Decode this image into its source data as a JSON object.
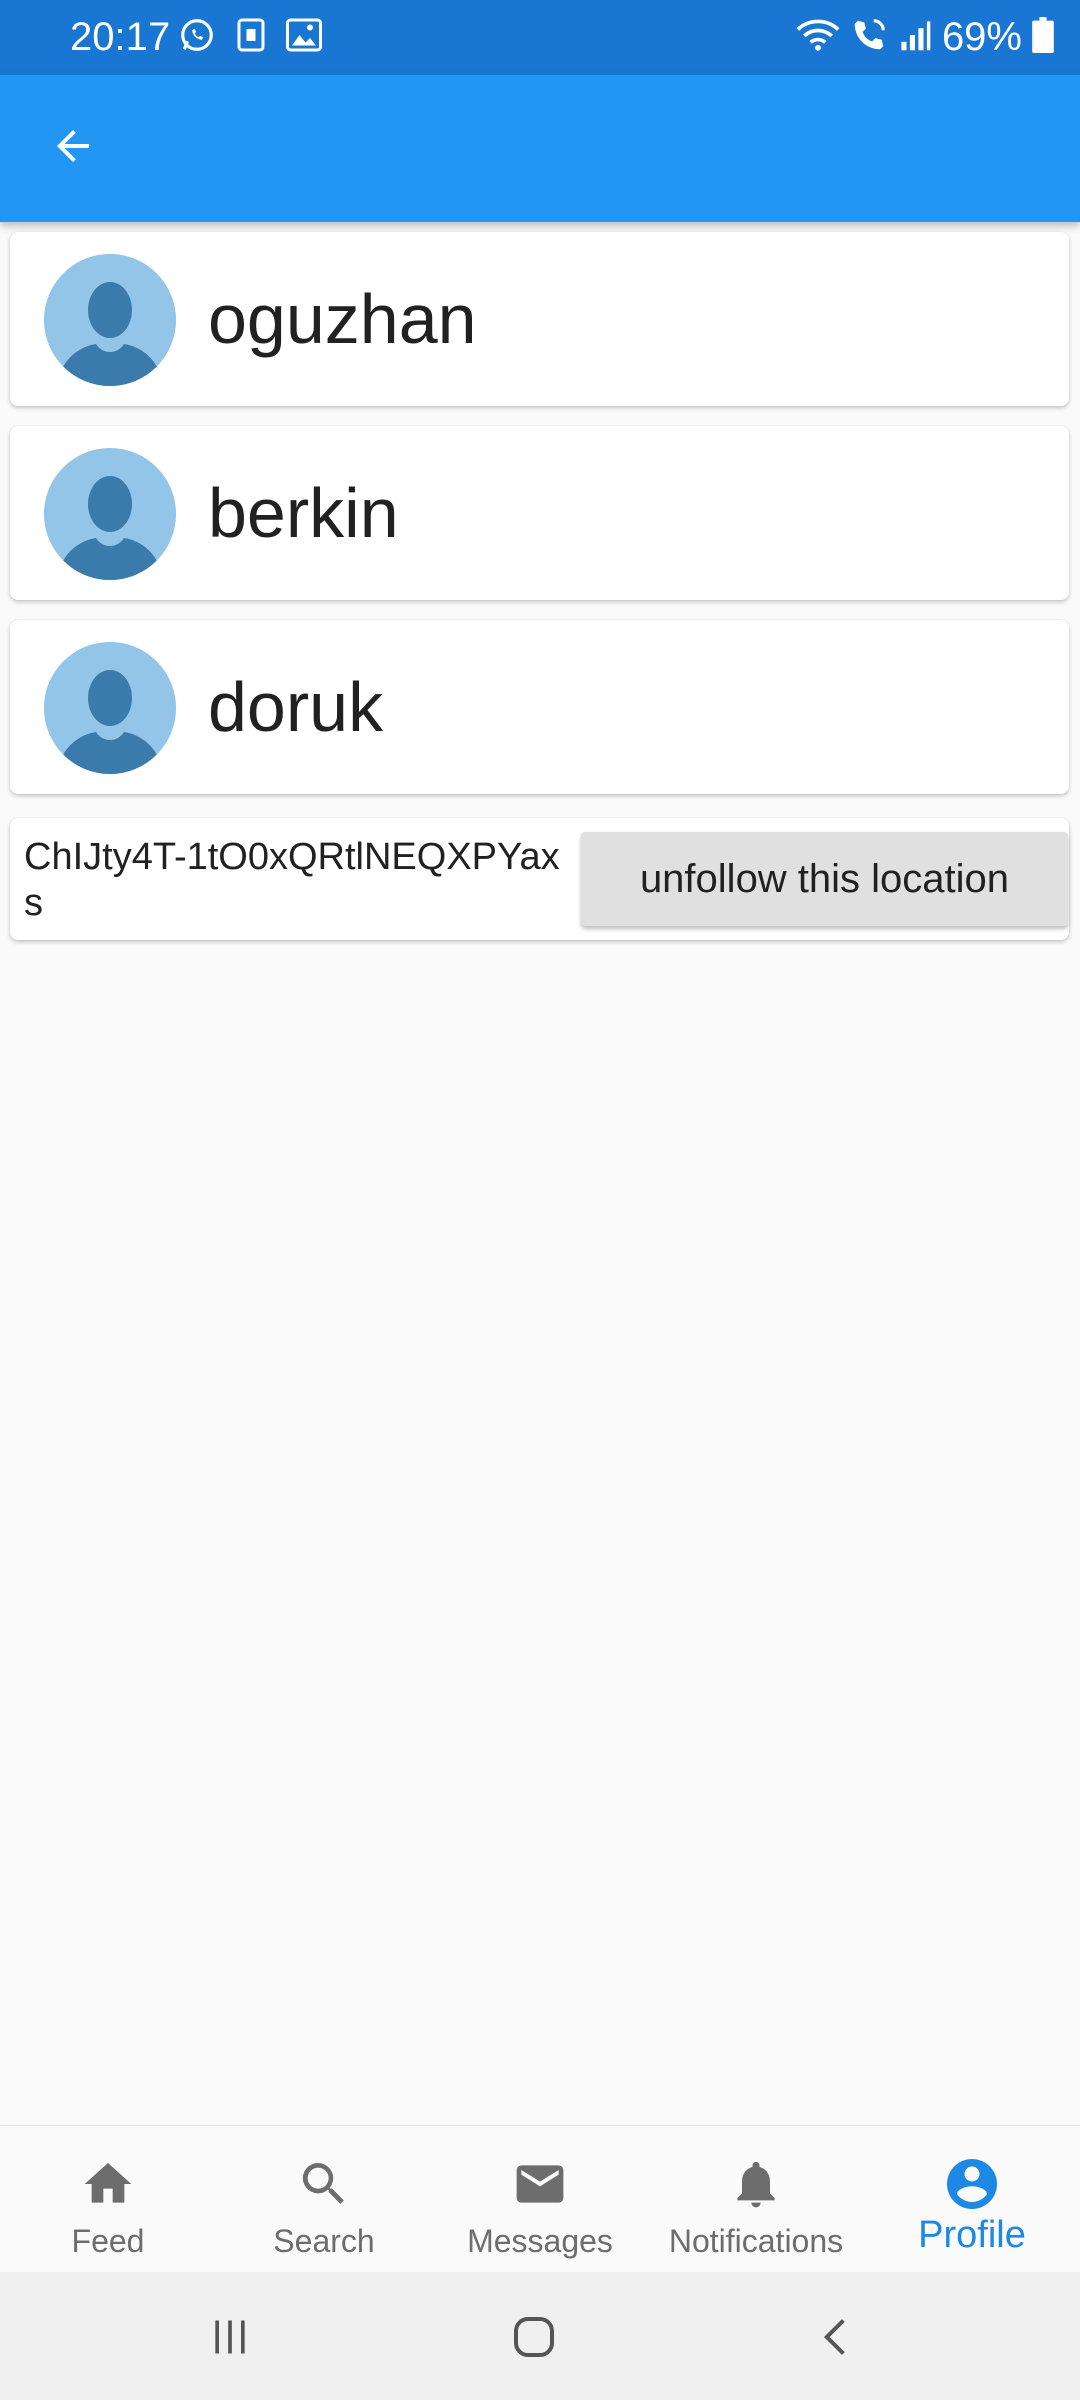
{
  "status_bar": {
    "time": "20:17",
    "battery_percent": "69%",
    "left_icons": [
      "whatsapp-icon",
      "sim-icon",
      "gallery-icon"
    ],
    "right_icons": [
      "wifi-icon",
      "wifi-calling-icon",
      "signal-icon",
      "battery-icon"
    ]
  },
  "app_bar": {
    "back_icon": "arrow-left-icon",
    "color": "#2196f3"
  },
  "users": [
    {
      "name": "oguzhan",
      "avatar_icon": "default-avatar-icon"
    },
    {
      "name": "berkin",
      "avatar_icon": "default-avatar-icon"
    },
    {
      "name": "doruk",
      "avatar_icon": "default-avatar-icon"
    }
  ],
  "location": {
    "id_text": "ChIJty4T-1tO0xQRtlNEQXPYaxs",
    "unfollow_label": "unfollow this location"
  },
  "bottom_nav": {
    "items": [
      {
        "label": "Feed",
        "icon": "home-icon",
        "active": false
      },
      {
        "label": "Search",
        "icon": "search-icon",
        "active": false
      },
      {
        "label": "Messages",
        "icon": "mail-icon",
        "active": false
      },
      {
        "label": "Notifications",
        "icon": "bell-icon",
        "active": false
      },
      {
        "label": "Profile",
        "icon": "account-circle-icon",
        "active": true
      }
    ],
    "active_color": "#1e88e5",
    "inactive_color": "#6d6d6d"
  },
  "system_nav": {
    "buttons": [
      "recents-icon",
      "home-button-icon",
      "back-icon"
    ]
  }
}
